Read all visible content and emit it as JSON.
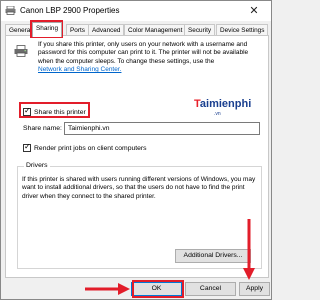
{
  "window": {
    "title": "Canon LBP 2900 Properties",
    "close_label": "✕"
  },
  "tabs": [
    {
      "label": "Genera"
    },
    {
      "label": "Sharing"
    },
    {
      "label": "Ports"
    },
    {
      "label": "Advanced"
    },
    {
      "label": "Color Management"
    },
    {
      "label": "Security"
    },
    {
      "label": "Device Settings"
    }
  ],
  "sharing": {
    "intro": "If you share this printer, only users on your network with a username and password for this computer can print to it. The printer will not be available when the computer sleeps. To change these settings, use the",
    "link": "Network and Sharing Center.",
    "share_checkbox_label": "Share this printer",
    "share_checkbox_checked": true,
    "share_name_label": "Share name:",
    "share_name_value": "Taimienphi.vn",
    "render_checkbox_label": "Render print jobs on client computers",
    "render_checkbox_checked": true
  },
  "drivers": {
    "title": "Drivers",
    "text": "If this printer is shared with users running different versions of Windows, you may want to install additional drivers, so that the users do not have to find the print driver when they connect to the shared printer.",
    "button": "Additional Drivers..."
  },
  "footer": {
    "ok": "OK",
    "cancel": "Cancel",
    "apply": "Apply"
  },
  "watermark": {
    "prefix": "T",
    "rest": "aimienphi",
    "sub": ".vn"
  },
  "colors": {
    "highlight": "#e21d2a",
    "link": "#0066cc",
    "focus_border": "#0078d7"
  },
  "icons": {
    "title_icon": "printer-icon",
    "panel_icon": "printer-icon",
    "check": "✓"
  }
}
